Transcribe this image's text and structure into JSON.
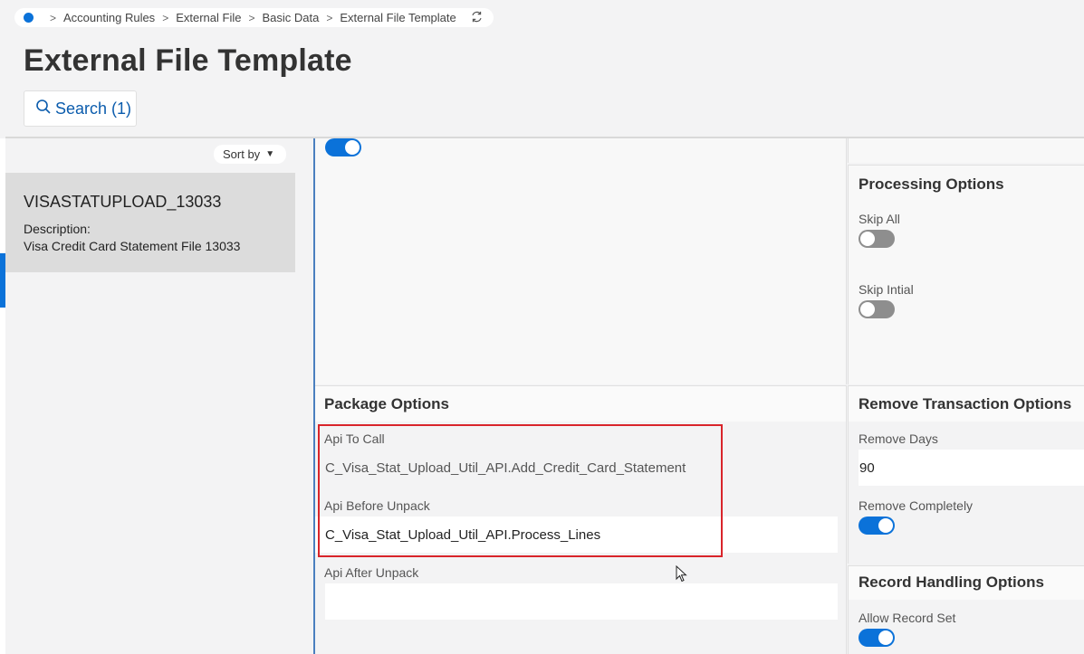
{
  "breadcrumb": {
    "items": [
      "Accounting Rules",
      "External File",
      "Basic Data",
      "External File Template"
    ]
  },
  "page": {
    "title": "External File Template"
  },
  "search": {
    "label": "Search (1)"
  },
  "list": {
    "sort_label": "Sort by",
    "item": {
      "title": "VISASTATUPLOAD_13033",
      "desc_label": "Description:",
      "desc_value": "Visa Credit Card Statement File 13033"
    }
  },
  "processing_options": {
    "title": "Processing Options",
    "skip_all_label": "Skip All",
    "skip_all_on": false,
    "skip_initial_label": "Skip Intial",
    "skip_initial_on": false
  },
  "top_toggle_on": true,
  "package_options": {
    "title": "Package Options",
    "api_to_call_label": "Api To Call",
    "api_to_call_value": "C_Visa_Stat_Upload_Util_API.Add_Credit_Card_Statement",
    "api_before_unpack_label": "Api Before Unpack",
    "api_before_unpack_value": "C_Visa_Stat_Upload_Util_API.Process_Lines",
    "api_after_unpack_label": "Api After Unpack",
    "api_after_unpack_value": ""
  },
  "remove_transaction_options": {
    "title": "Remove Transaction Options",
    "remove_days_label": "Remove Days",
    "remove_days_value": "90",
    "remove_completely_label": "Remove Completely",
    "remove_completely_on": true
  },
  "record_handling_options": {
    "title": "Record Handling Options",
    "allow_record_set_label": "Allow Record Set",
    "allow_record_set_on": true
  },
  "colors": {
    "accent": "#0b72d9",
    "highlight": "#d9242a"
  }
}
